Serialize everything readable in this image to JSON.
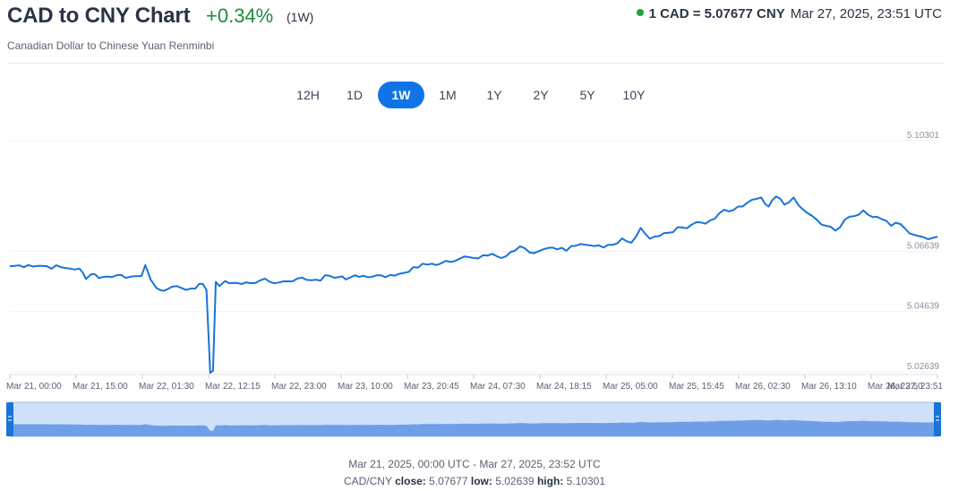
{
  "header": {
    "title": "CAD to CNY Chart",
    "change": "+0.34%",
    "period_tag": "(1W)",
    "subtitle": "Canadian Dollar to Chinese Yuan Renminbi",
    "rate": "1 CAD = 5.07677 CNY",
    "timestamp": "Mar 27, 2025, 23:51 UTC",
    "live_color": "#21a047"
  },
  "tabs": [
    {
      "label": "12H",
      "active": false
    },
    {
      "label": "1D",
      "active": false
    },
    {
      "label": "1W",
      "active": true
    },
    {
      "label": "1M",
      "active": false
    },
    {
      "label": "1Y",
      "active": false
    },
    {
      "label": "2Y",
      "active": false
    },
    {
      "label": "5Y",
      "active": false
    },
    {
      "label": "10Y",
      "active": false
    }
  ],
  "chart_data": {
    "type": "line",
    "ylim": [
      5.0255,
      5.1045
    ],
    "yticks": [
      "5.10301",
      "5.06639",
      "5.04639",
      "5.02639"
    ],
    "xtick_labels": [
      "Mar 21, 00:00",
      "Mar 21, 15:00",
      "Mar 22, 01:30",
      "Mar 22, 12:15",
      "Mar 22, 23:00",
      "Mar 23, 10:00",
      "Mar 23, 20:45",
      "Mar 24, 07:30",
      "Mar 24, 18:15",
      "Mar 25, 05:00",
      "Mar 25, 15:45",
      "Mar 26, 02:30",
      "Mar 26, 13:10",
      "Mar 26, 23:50",
      "Mar 27, 23:51"
    ],
    "series": [
      {
        "color": "#1874d8",
        "x": [
          0,
          0.02,
          0.04,
          0.06,
          0.075,
          0.082,
          0.088,
          0.1,
          0.115,
          0.13,
          0.142,
          0.146,
          0.152,
          0.158,
          0.17,
          0.185,
          0.2,
          0.208,
          0.212,
          0.216,
          0.219,
          0.222,
          0.226,
          0.232,
          0.25,
          0.27,
          0.29,
          0.31,
          0.33,
          0.345,
          0.355,
          0.362,
          0.372,
          0.39,
          0.41,
          0.425,
          0.435,
          0.445,
          0.46,
          0.475,
          0.49,
          0.505,
          0.52,
          0.53,
          0.54,
          0.55,
          0.56,
          0.575,
          0.59,
          0.6,
          0.61,
          0.63,
          0.645,
          0.655,
          0.66,
          0.67,
          0.68,
          0.69,
          0.7,
          0.71,
          0.725,
          0.74,
          0.75,
          0.765,
          0.78,
          0.79,
          0.8,
          0.81,
          0.818,
          0.826,
          0.835,
          0.845,
          0.86,
          0.875,
          0.89,
          0.905,
          0.92,
          0.94,
          0.95,
          0.955,
          0.965,
          0.975,
          0.985,
          1.0
        ],
        "values": [
          5.0614,
          5.0618,
          5.0614,
          5.0608,
          5.0606,
          5.0572,
          5.0588,
          5.0578,
          5.0584,
          5.0579,
          5.0582,
          5.0618,
          5.0568,
          5.0542,
          5.0538,
          5.0542,
          5.054,
          5.0556,
          5.0535,
          5.026,
          5.0268,
          5.0562,
          5.0548,
          5.0565,
          5.0555,
          5.0567,
          5.056,
          5.0573,
          5.0569,
          5.0582,
          5.0578,
          5.057,
          5.0584,
          5.0578,
          5.0585,
          5.0592,
          5.0611,
          5.0622,
          5.0618,
          5.0628,
          5.0646,
          5.064,
          5.0655,
          5.0641,
          5.0661,
          5.068,
          5.066,
          5.067,
          5.067,
          5.0665,
          5.0682,
          5.0681,
          5.0685,
          5.069,
          5.0706,
          5.0692,
          5.0741,
          5.0705,
          5.0714,
          5.0725,
          5.0742,
          5.076,
          5.0755,
          5.079,
          5.08,
          5.0812,
          5.0834,
          5.0842,
          5.0812,
          5.0845,
          5.0818,
          5.0842,
          5.079,
          5.0752,
          5.0732,
          5.0778,
          5.0799,
          5.077,
          5.0748,
          5.0758,
          5.0739,
          5.0718,
          5.071,
          5.0712
        ]
      }
    ]
  },
  "footer": {
    "range": "Mar 21, 2025, 00:00 UTC - Mar 27, 2025, 23:52 UTC",
    "pair": "CAD/CNY",
    "close_label": "close:",
    "close_value": "5.07677",
    "low_label": "low:",
    "low_value": "5.02639",
    "high_label": "high:",
    "high_value": "5.10301"
  }
}
